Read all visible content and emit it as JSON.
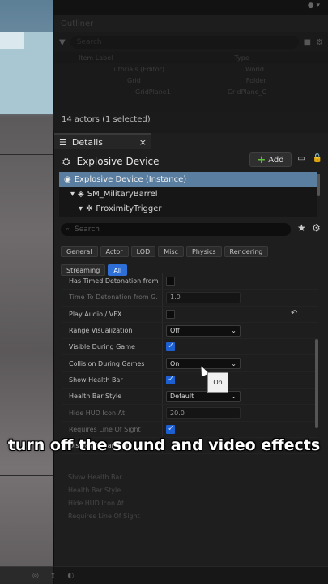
{
  "outliner": {
    "tab_label": "Outliner",
    "search_placeholder": "Search",
    "col_item": "Item Label",
    "col_type": "Type",
    "rows": [
      {
        "label": "Tutorials (Editor)",
        "type": "World"
      },
      {
        "label": "Grid",
        "type": "Folder"
      },
      {
        "label": "GridPlane1",
        "type": "GridPlane_C"
      }
    ],
    "actor_count": "14 actors (1 selected)"
  },
  "details": {
    "tab_label": "Details",
    "close_icon": "×",
    "object_name": "Explosive Device",
    "add_label": "Add",
    "tree": [
      {
        "label": "Explosive Device (Instance)",
        "selected": true
      },
      {
        "label": "SM_MilitaryBarrel",
        "selected": false
      },
      {
        "label": "ProximityTrigger",
        "selected": false
      }
    ],
    "search_placeholder": "Search",
    "filters": [
      "General",
      "Actor",
      "LOD",
      "Misc",
      "Physics",
      "Rendering",
      "Streaming",
      "All"
    ],
    "active_filter": "All",
    "properties": [
      {
        "label": "Has Timed Detonation from...",
        "kind": "checkbox",
        "checked": false,
        "dim": false
      },
      {
        "label": "Time To Detonation from G...",
        "kind": "number",
        "value": "1.0",
        "dim": true
      },
      {
        "label": "Play Audio / VFX",
        "kind": "checkbox",
        "checked": false,
        "dim": false,
        "reset": true
      },
      {
        "label": "Range Visualization",
        "kind": "dropdown",
        "value": "Off",
        "dim": false
      },
      {
        "label": "Visible During Game",
        "kind": "checkbox",
        "checked": true,
        "dim": false
      },
      {
        "label": "Collision During Games",
        "kind": "dropdown",
        "value": "On",
        "dim": false
      },
      {
        "label": "Show Health Bar",
        "kind": "checkbox",
        "checked": true,
        "dim": false
      },
      {
        "label": "Health Bar Style",
        "kind": "dropdown",
        "value": "Default",
        "dim": false
      },
      {
        "label": "Hide HUD Icon At",
        "kind": "number",
        "value": "20.0",
        "dim": true
      },
      {
        "label": "Requires Line Of Sight",
        "kind": "checkbox",
        "checked": true,
        "dim": true
      },
      {
        "label": "Display Distance Tr...",
        "kind": "none",
        "dim": false
      }
    ],
    "tooltip": "On"
  },
  "caption": "turn off the sound and video effects",
  "colors": {
    "accent": "#2d6fd6",
    "selection": "#5a7ea0",
    "add_plus": "#5fbf3a"
  }
}
